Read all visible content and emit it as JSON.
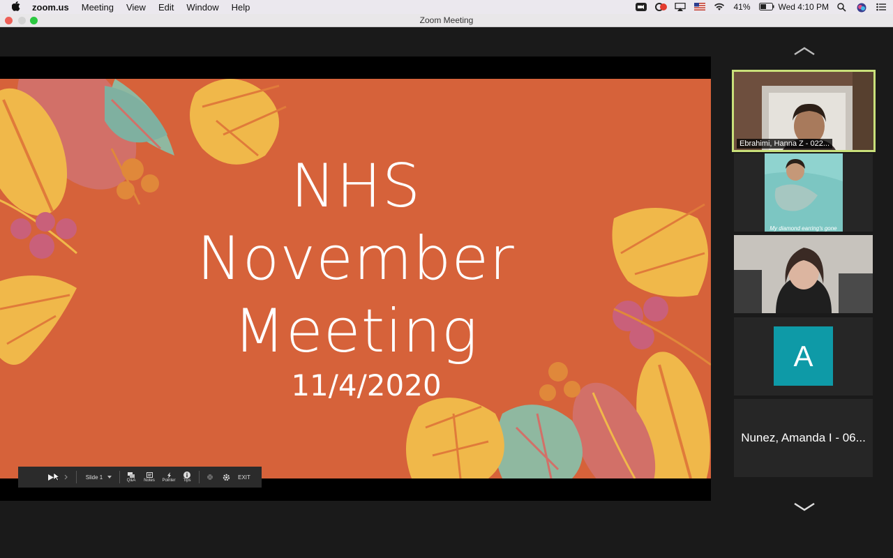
{
  "menubar": {
    "app_name": "zoom.us",
    "items": [
      "Meeting",
      "View",
      "Edit",
      "Window",
      "Help"
    ],
    "battery": "41%",
    "clock": "Wed 4:10 PM"
  },
  "window": {
    "title": "Zoom Meeting"
  },
  "slide": {
    "title_lines": [
      "NHS",
      "November",
      "Meeting"
    ],
    "date": "11/4/2020",
    "background_color": "#d6623a"
  },
  "presenter_toolbar": {
    "slide_label": "Slide 1",
    "qa_label": "Q&A",
    "notes_label": "Notes",
    "pointer_label": "Pointer",
    "tips_label": "Tips",
    "exit_label": "EXIT"
  },
  "participants": [
    {
      "name": "Ebrahimi, Hanna Z - 022...",
      "active_speaker": true
    },
    {
      "caption": "My diamond earring's gone"
    },
    {},
    {
      "avatar_letter": "A"
    },
    {
      "name": "Nunez, Amanda I - 06..."
    }
  ],
  "colors": {
    "active_border": "#c9e07a",
    "avatar_bg": "#0e9aa7"
  }
}
